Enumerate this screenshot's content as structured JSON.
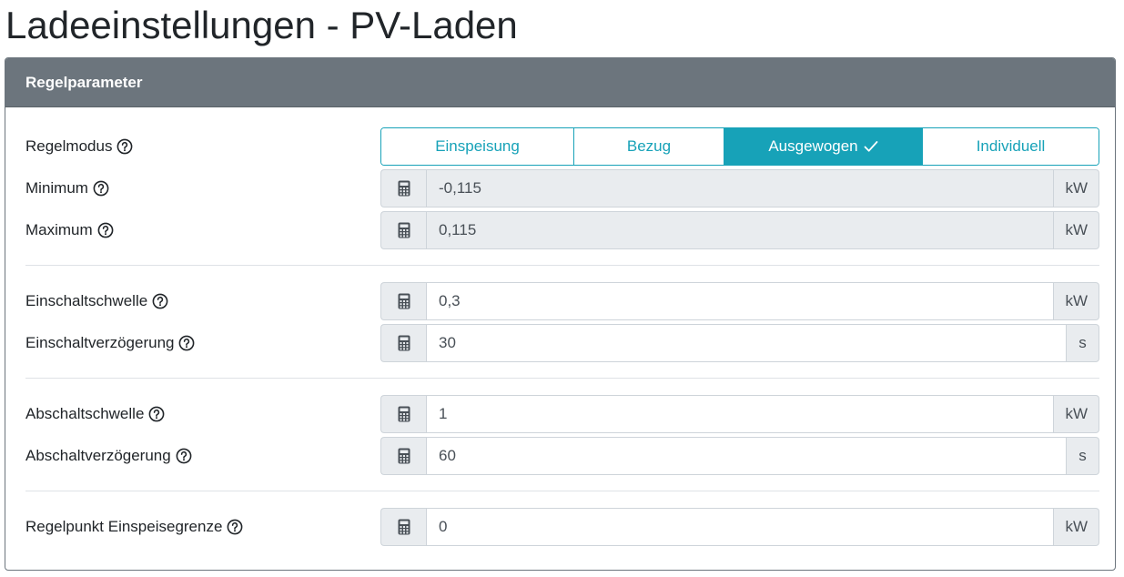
{
  "page": {
    "title": "Ladeeinstellungen - PV-Laden"
  },
  "card": {
    "header": "Regelparameter"
  },
  "regelmodus": {
    "label": "Regelmodus",
    "options": [
      {
        "label": "Einspeisung",
        "active": false
      },
      {
        "label": "Bezug",
        "active": false
      },
      {
        "label": "Ausgewogen",
        "active": true
      },
      {
        "label": "Individuell",
        "active": false
      }
    ]
  },
  "fields": {
    "minimum": {
      "label": "Minimum",
      "value": "-0,115",
      "unit": "kW",
      "readonly": true
    },
    "maximum": {
      "label": "Maximum",
      "value": "0,115",
      "unit": "kW",
      "readonly": true
    },
    "einschaltschwelle": {
      "label": "Einschaltschwelle",
      "value": "0,3",
      "unit": "kW",
      "readonly": false
    },
    "einschaltverzoegerung": {
      "label": "Einschaltverzögerung",
      "value": "30",
      "unit": "s",
      "readonly": false
    },
    "abschaltschwelle": {
      "label": "Abschaltschwelle",
      "value": "1",
      "unit": "kW",
      "readonly": false
    },
    "abschaltverzoegerung": {
      "label": "Abschaltverzögerung",
      "value": "60",
      "unit": "s",
      "readonly": false
    },
    "regelpunkt": {
      "label": "Regelpunkt Einspeisegrenze",
      "value": "0",
      "unit": "kW",
      "readonly": false
    }
  },
  "icons": {
    "help": "question-circle-icon",
    "calculator": "calculator-icon",
    "check": "check-icon"
  },
  "colors": {
    "header_bg": "#6c757d",
    "accent": "#17a2b8",
    "addon_bg": "#e9ecef"
  }
}
